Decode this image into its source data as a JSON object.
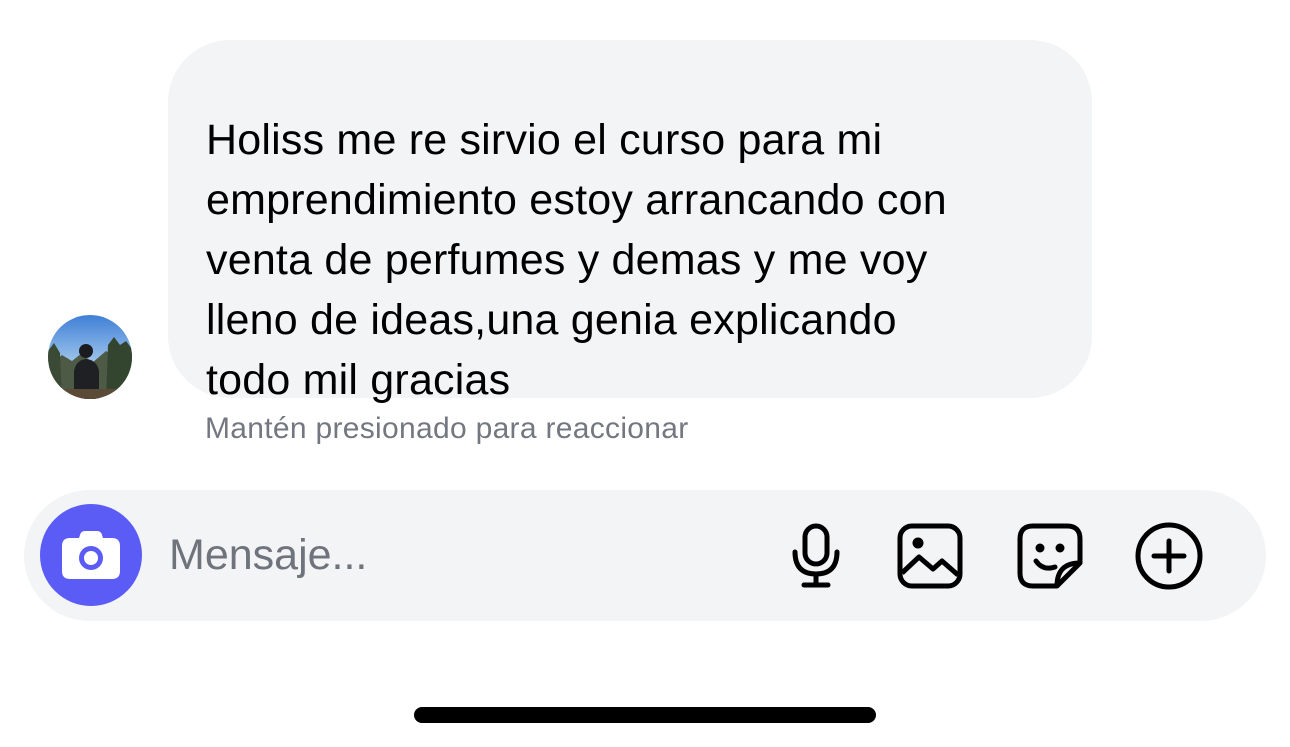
{
  "message": {
    "text": "Holiss me re sirvio el curso para mi\nemprendimiento estoy arrancando con\nventa de perfumes y demas y me voy\nlleno de ideas,una genia explicando\ntodo mil gracias"
  },
  "hint": "Mantén presionado para reaccionar",
  "composer": {
    "placeholder": "Mensaje...",
    "camera_color": "#5b5bf6",
    "icons": [
      "camera-icon",
      "microphone-icon",
      "gallery-icon",
      "sticker-icon",
      "plus-icon"
    ]
  },
  "colors": {
    "bubble": "#f3f4f6",
    "hint": "#737780",
    "accent": "#5b5bf6"
  }
}
